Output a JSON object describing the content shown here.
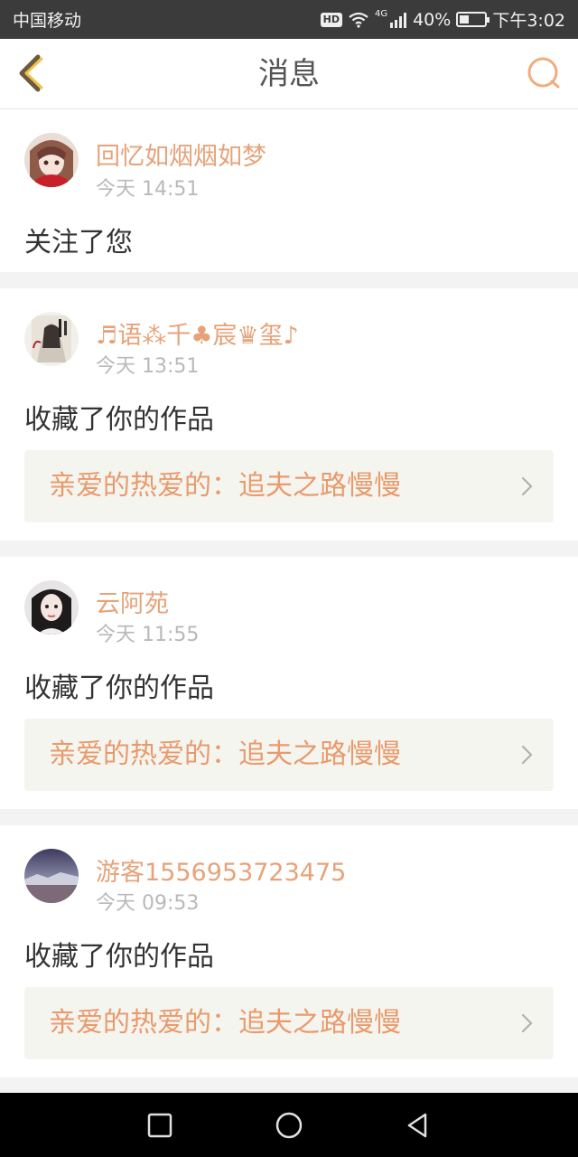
{
  "status_bar": {
    "carrier": "中国移动",
    "hd": "HD",
    "network": "4G",
    "battery": "40%",
    "battery_level": 0.4,
    "time": "下午3:02"
  },
  "nav": {
    "title": "消息",
    "back_icon": "chevron-left-icon",
    "search_icon": "search-icon",
    "accent": "#f0ad7c"
  },
  "messages": [
    {
      "username": "回忆如烟烟如梦",
      "time": "今天 14:51",
      "action": "关注了您"
    },
    {
      "username": "♬语⁂千♣宸♛玺♪",
      "time": "今天 13:51",
      "action": "收藏了你的作品",
      "work": "亲爱的热爱的：追夫之路慢慢"
    },
    {
      "username": "云阿苑",
      "time": "今天 11:55",
      "action": "收藏了你的作品",
      "work": "亲爱的热爱的：追夫之路慢慢"
    },
    {
      "username": "游客1556953723475",
      "time": "今天 09:53",
      "action": "收藏了你的作品",
      "work": "亲爱的热爱的：追夫之路慢慢"
    }
  ],
  "colors": {
    "username": "#e6a37a",
    "work_title": "#e99a6c",
    "timestamp": "#b9b9b9",
    "background": "#f4f3f3"
  },
  "system_nav": {
    "recent_icon": "square-icon",
    "home_icon": "circle-icon",
    "back_icon": "triangle-back-icon"
  }
}
